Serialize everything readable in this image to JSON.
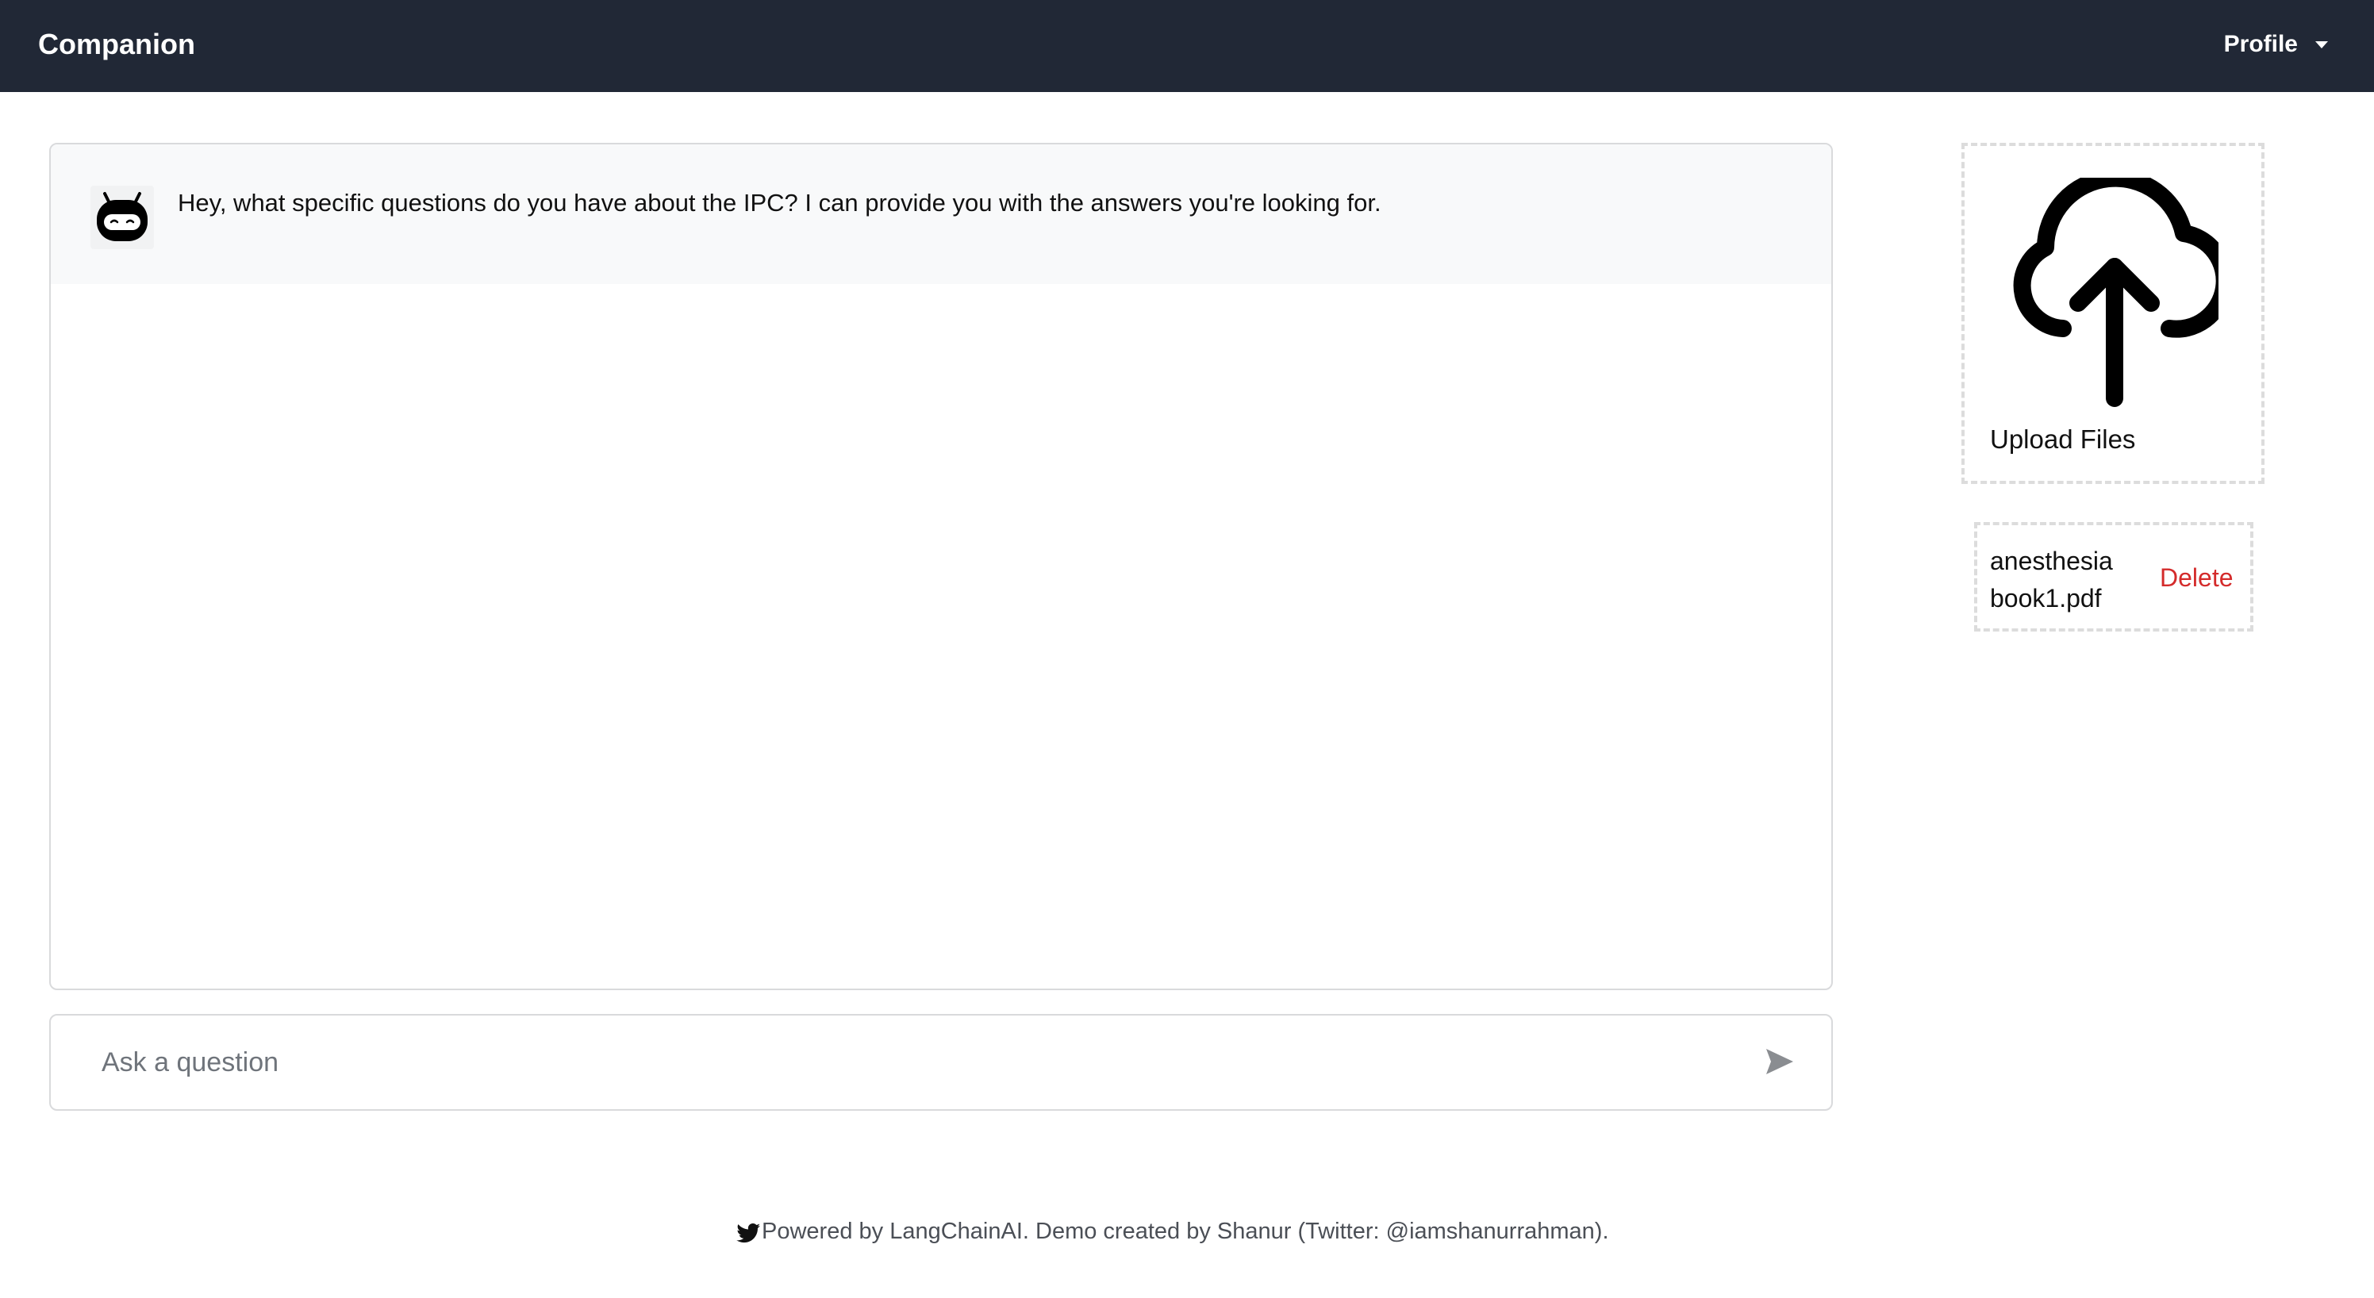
{
  "navbar": {
    "brand": "Companion",
    "profile_label": "Profile"
  },
  "chat": {
    "messages": [
      {
        "role": "assistant",
        "avatar_icon": "robot-icon",
        "text": "Hey, what specific questions do you have about the IPC? I can provide you with the answers you're looking for."
      }
    ]
  },
  "input": {
    "placeholder": "Ask a question",
    "value": "",
    "send_icon": "send-icon"
  },
  "upload": {
    "icon": "cloud-upload-icon",
    "label": "Upload Files"
  },
  "files": [
    {
      "name_line1": "anesthesia",
      "name_line2": "book1.pdf",
      "delete_label": "Delete"
    }
  ],
  "footer": {
    "icon": "twitter-icon",
    "text": "Powered by LangChainAI. Demo created by Shanur (Twitter: @iamshanurrahman)."
  },
  "colors": {
    "navbar_bg": "#212836",
    "delete": "#d42b2b",
    "message_bg": "#f8f9fa"
  }
}
